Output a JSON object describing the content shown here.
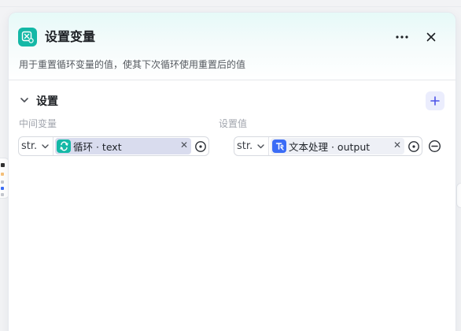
{
  "node": {
    "title": "设置变量",
    "description": "用于重置循环变量的值，使其下次循环使用重置后的值",
    "icon": "set-variable-icon",
    "accent_color": "#14b8a6"
  },
  "header": {
    "more_icon": "more-horizontal-icon",
    "close_icon": "close-icon"
  },
  "section": {
    "title": "设置",
    "add_icon": "plus-icon"
  },
  "columns": {
    "left_label": "中间变量",
    "right_label": "设置值"
  },
  "rows": [
    {
      "left": {
        "type": "str.",
        "source": "循环",
        "variable": "text",
        "tag_label": "循环 · text",
        "icon": "loop-icon",
        "icon_color": "#14b8a6"
      },
      "right": {
        "type": "str.",
        "source": "文本处理",
        "variable": "output",
        "tag_label": "文本处理 · output",
        "icon": "text-process-icon",
        "icon_color": "#3b6cf6"
      }
    }
  ]
}
